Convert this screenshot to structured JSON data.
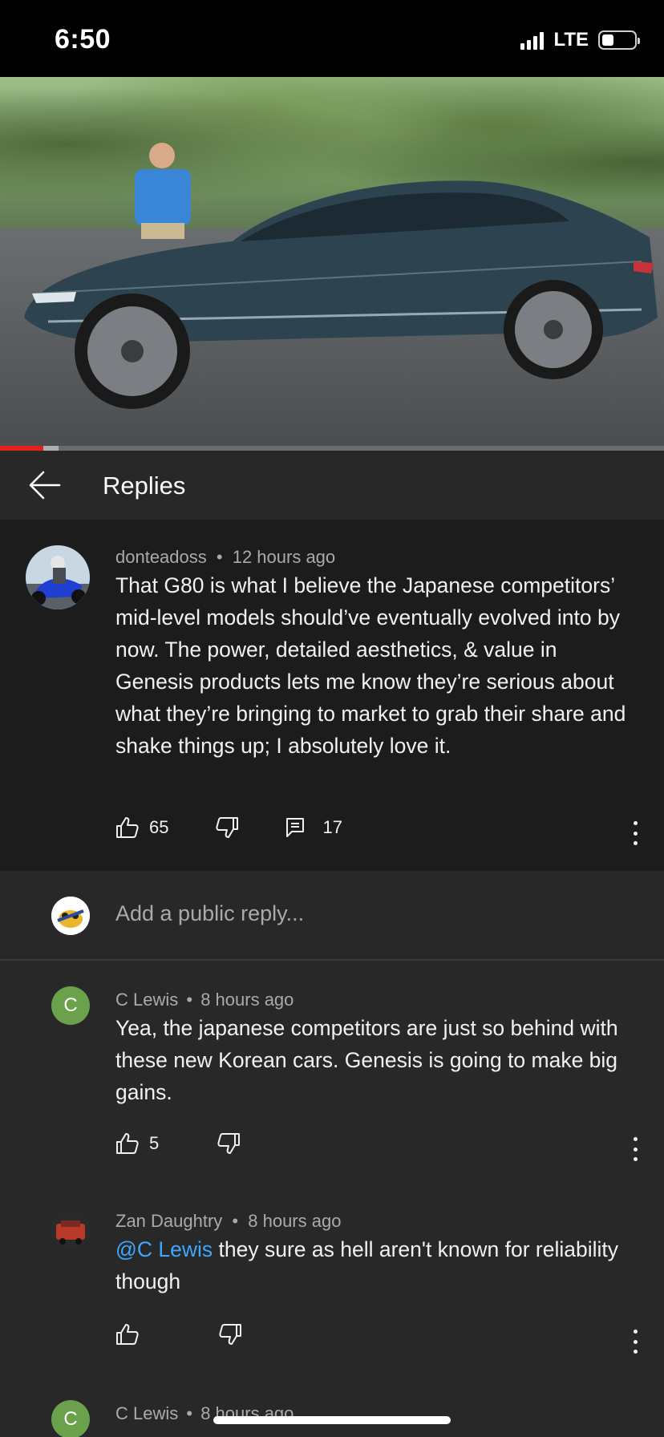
{
  "status_bar": {
    "time": "6:50",
    "network": "LTE"
  },
  "video": {
    "progress_played_fraction": 0.065,
    "progress_buffered_fraction": 0.088
  },
  "header": {
    "title": "Replies"
  },
  "parent_comment": {
    "author": "donteadoss",
    "time": "12 hours ago",
    "text": "That G80 is what I believe the Japanese competitors’ mid-level models should’ve eventually evolved into by now. The power, detailed aesthetics, & value in Genesis products lets me know they’re serious about what they’re bringing to market to grab their share and shake things up; I absolutely love it.",
    "likes": "65",
    "replies": "17"
  },
  "reply_input": {
    "placeholder": "Add a public reply..."
  },
  "replies": [
    {
      "author": "C Lewis",
      "time": "8 hours ago",
      "avatar_letter": "C",
      "text": "Yea, the japanese competitors are just so behind with these new Korean cars. Genesis is going to make big gains.",
      "likes": "5"
    },
    {
      "author": "Zan Daughtry",
      "time": "8 hours ago",
      "mention": "@C Lewis",
      "text": " they sure as hell aren't known for reliability though",
      "likes": ""
    },
    {
      "author": "C Lewis",
      "time": "8 hours ago",
      "avatar_letter": "C"
    }
  ],
  "meta_separator": "•",
  "colors": {
    "background": "#282828",
    "parent_background": "#1c1c1c",
    "mention": "#3ea6ff",
    "progress": "#e62117",
    "letter_avatar": "#6aa14a"
  }
}
